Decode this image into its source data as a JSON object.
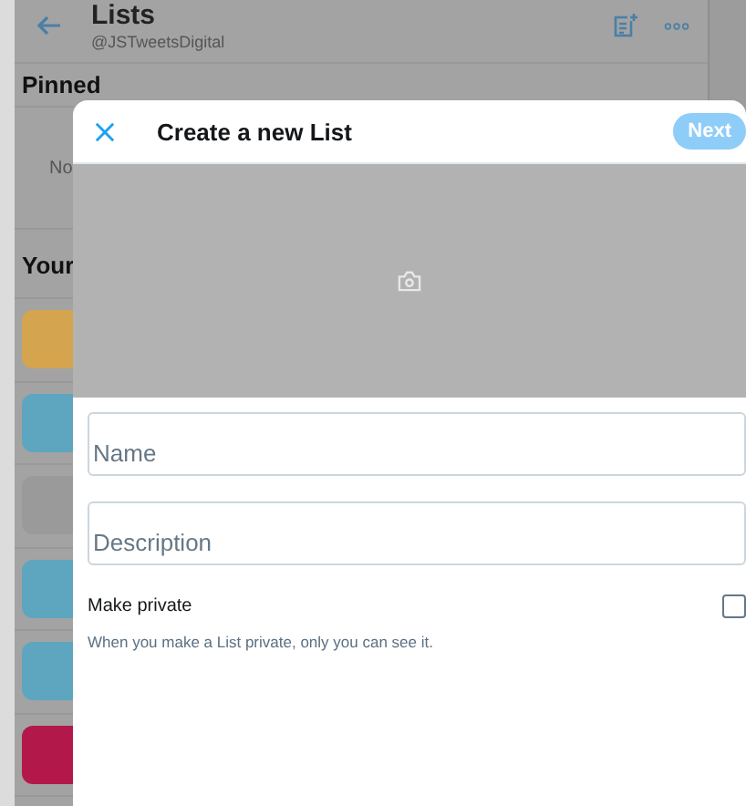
{
  "page": {
    "title": "Lists",
    "handle": "@JSTweetsDigital",
    "pinned": {
      "heading": "Pinned",
      "text": "No"
    },
    "yours": {
      "heading": "Your"
    },
    "list_tiles": [
      {
        "color": "#d4a54e"
      },
      {
        "color": "#5ea6c0"
      },
      {
        "color": "#9a9a9a"
      },
      {
        "color": "#5ea6c0"
      },
      {
        "color": "#5ea6c0"
      },
      {
        "color": "#b3184a"
      }
    ]
  },
  "dialog": {
    "title": "Create a new List",
    "next_button": {
      "label": "Next",
      "disabled": true
    },
    "fields": [
      {
        "placeholder": "Name"
      },
      {
        "placeholder": "Description"
      }
    ],
    "private_toggle": {
      "label": "Make private",
      "hint": "When you make a List private, only you can see it.",
      "checked": false
    }
  }
}
